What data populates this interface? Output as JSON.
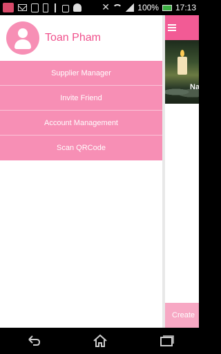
{
  "status_bar": {
    "battery_text": "100%",
    "time": "17:13"
  },
  "drawer": {
    "user_name": "Toan Pham",
    "menu": [
      {
        "label": "Supplier Manager"
      },
      {
        "label": "Invite Friend"
      },
      {
        "label": "Account Management"
      },
      {
        "label": "Scan QRCode"
      }
    ]
  },
  "main": {
    "card_title": "Na",
    "create_label": "Create"
  },
  "colors": {
    "accent": "#f25b95",
    "menu_bg": "#f78fb5",
    "name_text": "#f0508c"
  },
  "icons": {
    "nav_back": "back-icon",
    "nav_home": "home-icon",
    "nav_recent": "recent-apps-icon"
  }
}
